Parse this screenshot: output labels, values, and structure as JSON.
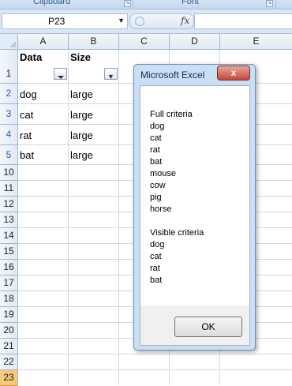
{
  "ribbon": {
    "groups": [
      "Clipboard",
      "Font"
    ],
    "launcher_glyph": "↘"
  },
  "formula_bar": {
    "name_box": "P23",
    "fx_label": "fx",
    "formula_value": ""
  },
  "columns": [
    "A",
    "B",
    "C",
    "D",
    "E"
  ],
  "rows": [
    "1",
    "2",
    "3",
    "4",
    "5",
    "10",
    "11",
    "12",
    "13",
    "14",
    "15",
    "16",
    "17",
    "18",
    "19",
    "20",
    "21",
    "22",
    "23"
  ],
  "cells": {
    "A1": "Data",
    "B1": "Size",
    "A2": "dog",
    "B2": "large",
    "A3": "cat",
    "B3": "large",
    "A4": "rat",
    "B4": "large",
    "A5": "bat",
    "B5": "large"
  },
  "dialog": {
    "title": "Microsoft Excel",
    "close_label": "x",
    "message_lines": [
      "Full criteria",
      "dog",
      "cat",
      "rat",
      "bat",
      "mouse",
      "cow",
      "pig",
      "horse",
      "",
      "Visible criteria",
      "dog",
      "cat",
      "rat",
      "bat"
    ],
    "ok_label": "OK"
  },
  "colors": {
    "header_bg": "#e1e9f3",
    "selected_row_header": "#f7c97a",
    "filtered_row_number": "#2a5cb5",
    "dialog_frame": "#c9dff4"
  }
}
